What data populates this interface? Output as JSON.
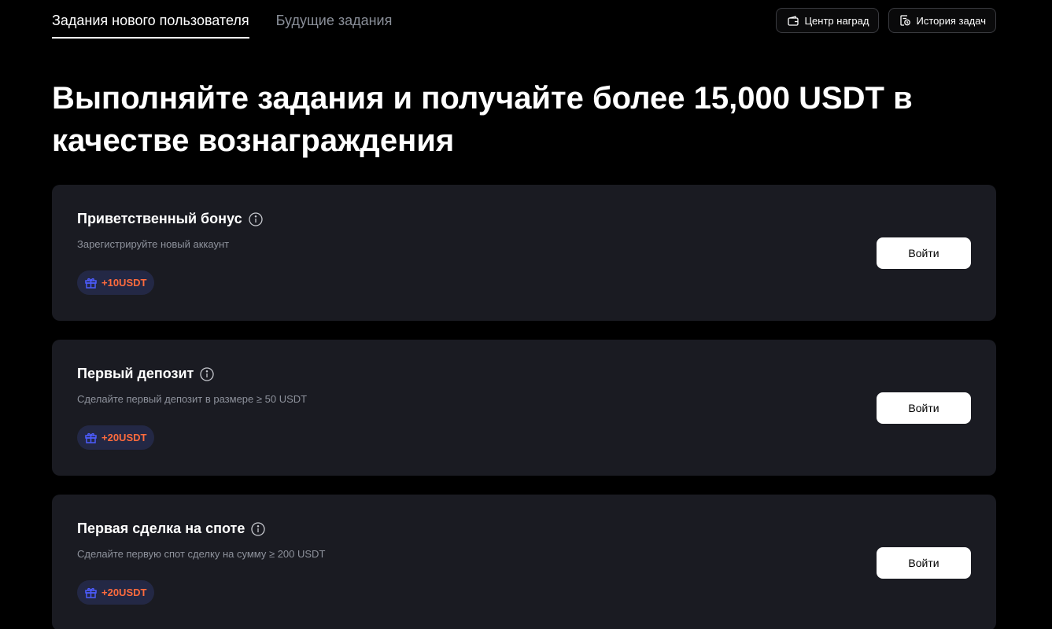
{
  "nav": {
    "tabs": [
      {
        "label": "Задания нового пользователя"
      },
      {
        "label": "Будущие задания"
      }
    ],
    "actions": [
      {
        "label": "Центр наград",
        "icon": "wallet-icon"
      },
      {
        "label": "История задач",
        "icon": "history-icon"
      }
    ]
  },
  "headline": "Выполняйте задания и получайте более 15,000 USDT в качестве вознаграждения",
  "tasks": [
    {
      "title": "Приветственный бонус",
      "description": "Зарегистрируйте новый аккаунт",
      "reward": "+10USDT",
      "button": "Войти"
    },
    {
      "title": "Первый депозит",
      "description": "Сделайте первый депозит в размере ≥ 50 USDT",
      "reward": "+20USDT",
      "button": "Войти"
    },
    {
      "title": "Первая сделка на споте",
      "description": "Сделайте первую спот сделку на сумму ≥ 200 USDT",
      "reward": "+20USDT",
      "button": "Войти"
    }
  ],
  "colors": {
    "background": "#000000",
    "card": "#1a1b22",
    "reward_text": "#ff6b3d",
    "reward_icon": "#4d5cff",
    "reward_bg": "#232845"
  }
}
